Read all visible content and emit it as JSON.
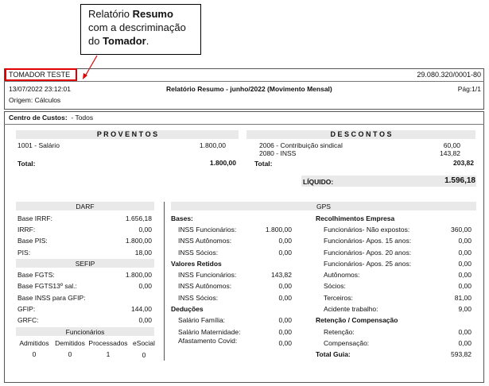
{
  "callout": {
    "line1_prefix": "Relatório ",
    "line1_bold": "Resumo",
    "line2": "com a descriminação",
    "line3_prefix": "do ",
    "line3_bold": "Tomador",
    "line3_suffix": "."
  },
  "header": {
    "tomador": "TOMADOR TESTE",
    "cnpj": "29.080.320/0001-80",
    "datetime": "13/07/2022 23:12:01",
    "report_title": "Relatório Resumo - junho/2022 (Movimento Mensal)",
    "page": "Pág:1/1",
    "origin": "Origem: Cálculos"
  },
  "centro": {
    "label": "Centro de Custos:",
    "value": "- Todos"
  },
  "proventos": {
    "title": "P R O V E N T O S",
    "items": [
      {
        "desc": "1001 - Salário",
        "value": "1.800,00"
      }
    ],
    "total_label": "Total:",
    "total_value": "1.800,00"
  },
  "descontos": {
    "title": "D E S C O N T O S",
    "items": [
      {
        "desc": "2006 - Contribuição sindical",
        "value": "60,00"
      },
      {
        "desc": "2080 - INSS",
        "value": "143,82"
      }
    ],
    "total_label": "Total:",
    "total_value": "203,82"
  },
  "liquido": {
    "label": "LÍQUIDO:",
    "value": "1.596,18"
  },
  "darf": {
    "title": "DARF",
    "rows": [
      {
        "label": "Base IRRF:",
        "value": "1.656,18"
      },
      {
        "label": "IRRF:",
        "value": "0,00"
      },
      {
        "label": "Base PIS:",
        "value": "1.800,00"
      },
      {
        "label": "PIS:",
        "value": "18,00"
      }
    ]
  },
  "sefip": {
    "title": "SEFIP",
    "rows": [
      {
        "label": "Base FGTS:",
        "value": "1.800,00"
      },
      {
        "label": "Base FGTS13º sal.:",
        "value": "0,00"
      },
      {
        "label": "Base INSS para GFIP:",
        "value": ""
      },
      {
        "label": "GFIP:",
        "value": "144,00"
      },
      {
        "label": "GRFC:",
        "value": "0,00"
      }
    ]
  },
  "funcionarios": {
    "title": "Funcionários",
    "headers": [
      "Admitidos",
      "Demitidos",
      "Processados",
      "eSocial"
    ],
    "values": [
      "0",
      "0",
      "1",
      "0"
    ]
  },
  "gps": {
    "title": "GPS",
    "bases_title": "Bases:",
    "bases": [
      {
        "label": "INSS Funcionários:",
        "value": "1.800,00"
      },
      {
        "label": "INSS Autônomos:",
        "value": "0,00"
      },
      {
        "label": "INSS Sócios:",
        "value": "0,00"
      }
    ],
    "retidos_title": "Valores Retidos",
    "retidos": [
      {
        "label": "INSS Funcionários:",
        "value": "143,82"
      },
      {
        "label": "INSS Autônomos:",
        "value": "0,00"
      },
      {
        "label": "INSS Sócios:",
        "value": "0,00"
      }
    ],
    "deducoes_title": "Deduções",
    "deducoes": [
      {
        "label": "Salário Família:",
        "value": "0,00"
      },
      {
        "label": "Salário Maternidade:",
        "value": "0,00"
      },
      {
        "label": "Afastamento Covid:",
        "value": "0,00"
      }
    ],
    "recolhimentos_title": "Recolhimentos Empresa",
    "recolhimentos": [
      {
        "label": "Funcionários- Não expostos:",
        "value": "360,00"
      },
      {
        "label": "Funcionários- Apos. 15 anos:",
        "value": "0,00"
      },
      {
        "label": "Funcionários- Apos. 20 anos:",
        "value": "0,00"
      },
      {
        "label": "Funcionários- Apos. 25 anos:",
        "value": "0,00"
      },
      {
        "label": "Autônomos:",
        "value": "0,00"
      },
      {
        "label": "Sócios:",
        "value": "0,00"
      },
      {
        "label": "Terceiros:",
        "value": "81,00"
      },
      {
        "label": "Acidente trabalho:",
        "value": "9,00"
      }
    ],
    "retencao_title": "Retenção / Compensação",
    "retencao": [
      {
        "label": "Retenção:",
        "value": "0,00"
      },
      {
        "label": "Compensação:",
        "value": "0,00"
      }
    ],
    "total_label": "Total Guia:",
    "total_value": "593,82"
  }
}
